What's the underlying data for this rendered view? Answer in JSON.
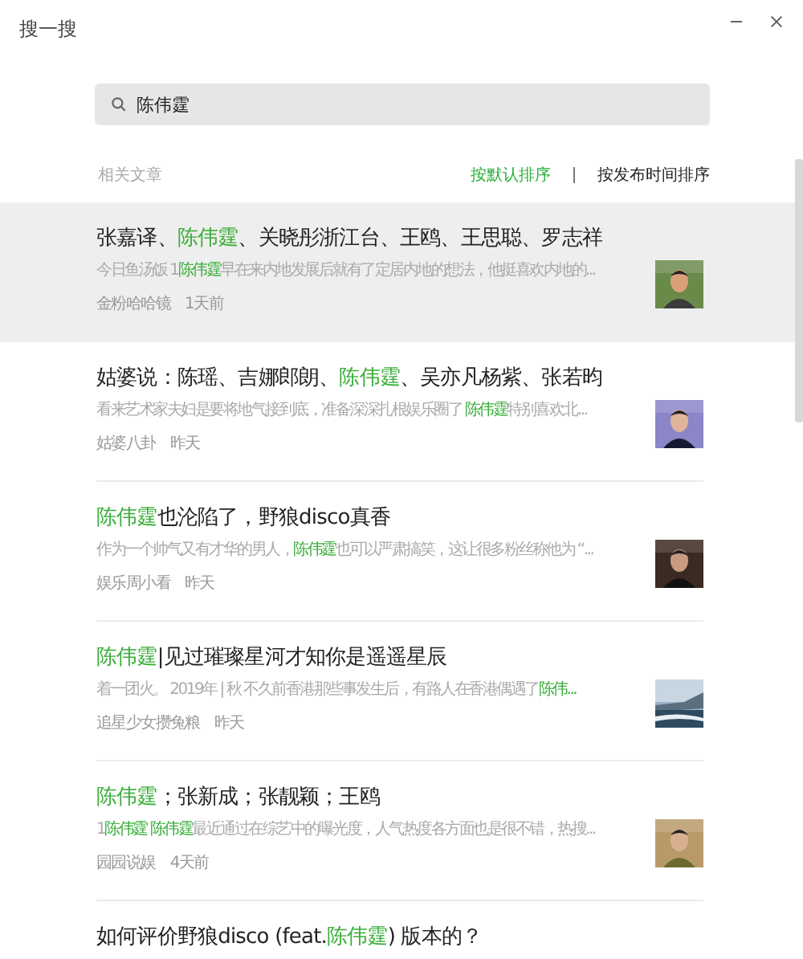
{
  "window": {
    "title": "搜一搜",
    "controls": [
      {
        "kind": "minimize"
      },
      {
        "kind": "close"
      }
    ]
  },
  "search": {
    "value": "陈伟霆"
  },
  "section_label": "相关文章",
  "sort_options": [
    {
      "label": "按默认排序",
      "selected": true
    },
    {
      "label": "按发布时间排序",
      "selected": false
    }
  ],
  "articles": [
    {
      "selected": true,
      "title": [
        {
          "text": "张嘉译、"
        },
        {
          "text": "陈伟霆",
          "highlight": true
        },
        {
          "text": "、关晓彤浙江台、王鸥、王思聪、罗志祥"
        }
      ],
      "snippet": [
        {
          "text": "今日鱼汤饭 1"
        },
        {
          "text": "陈伟霆",
          "highlight": true
        },
        {
          "text": "早在来内地发展后就有了定居内地的想法，他挺喜欢内地的..."
        }
      ],
      "source": "金粉哈哈镜",
      "time": "1天前",
      "thumbnail": {
        "kind": "picture"
      }
    },
    {
      "selected": false,
      "title": [
        {
          "text": "姑婆说：陈瑶、吉娜郎朗、"
        },
        {
          "text": "陈伟霆",
          "highlight": true
        },
        {
          "text": "、吴亦凡杨紫、张若昀"
        }
      ],
      "snippet": [
        {
          "text": "看来艺术家夫妇是要将地气接到底，准备深深扎根娱乐圈了 "
        },
        {
          "text": "陈伟霆",
          "highlight": true
        },
        {
          "text": "特别喜欢北..."
        }
      ],
      "source": "姑婆八卦",
      "time": "昨天",
      "thumbnail": {
        "kind": "picture"
      }
    },
    {
      "selected": false,
      "title": [
        {
          "text": "陈伟霆",
          "highlight": true
        },
        {
          "text": "也沦陷了，野狼disco真香"
        }
      ],
      "snippet": [
        {
          "text": "作为一个帅气又有才华的男人，"
        },
        {
          "text": "陈伟霆",
          "highlight": true
        },
        {
          "text": "也可以严肃搞笑，这让很多粉丝称他为 “..."
        }
      ],
      "source": "娱乐周小看",
      "time": "昨天",
      "thumbnail": {
        "kind": "picture"
      }
    },
    {
      "selected": false,
      "title": [
        {
          "text": "陈伟霆",
          "highlight": true
        },
        {
          "text": "|见过璀璨星河才知你是遥遥星辰"
        }
      ],
      "snippet": [
        {
          "text": "着一团火。 2019年 | 秋 不久前香港那些事发生后，有路人在香港偶遇了"
        },
        {
          "text": "陈伟...",
          "highlight": true
        }
      ],
      "source": "追星少女攒兔粮",
      "time": "昨天",
      "thumbnail": {
        "kind": "picture"
      }
    },
    {
      "selected": false,
      "title": [
        {
          "text": "陈伟霆",
          "highlight": true
        },
        {
          "text": "；张新成；张靓颖；王鸥"
        }
      ],
      "snippet": [
        {
          "text": "1"
        },
        {
          "text": "陈伟霆 陈伟霆",
          "highlight": true
        },
        {
          "text": "最近通过在综艺中的曝光度，人气热度各方面也是很不错，热搜..."
        }
      ],
      "source": "园园说娱",
      "time": "4天前",
      "thumbnail": {
        "kind": "picture"
      }
    },
    {
      "selected": false,
      "title": [
        {
          "text": "如何评价野狼disco (feat."
        },
        {
          "text": "陈伟霆",
          "highlight": true
        },
        {
          "text": ") 版本的？"
        }
      ]
    }
  ]
}
